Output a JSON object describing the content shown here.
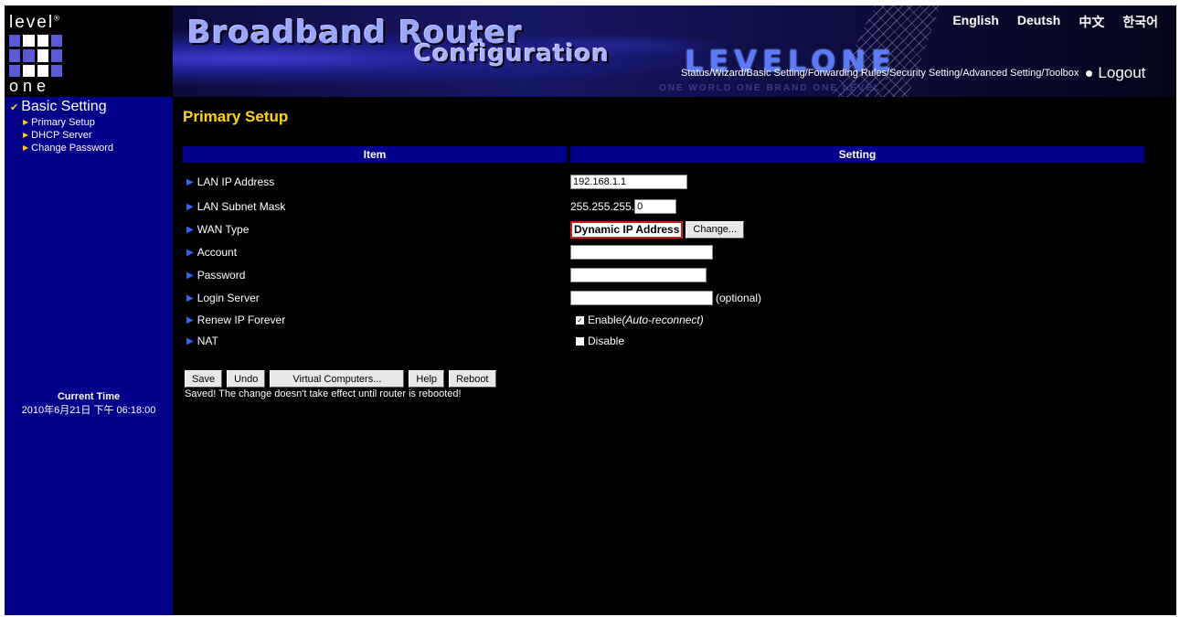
{
  "logo": {
    "top": "level",
    "tm": "®",
    "bottom": "one"
  },
  "banner": {
    "title_line1": "Broadband Router",
    "title_line2": "Configuration",
    "brand": "LEVELONE",
    "slogan": "ONE WORLD ONE BRAND ONE LEVEL"
  },
  "languages": [
    "English",
    "Deutsh",
    "中文",
    "한국어"
  ],
  "nav": {
    "items": [
      "Status",
      "Wizard",
      "Basic Setting",
      "Forwarding Rules",
      "Security Setting",
      "Advanced Setting",
      "Toolbox"
    ],
    "separator": "/ ",
    "logout": "Logout"
  },
  "sidebar": {
    "section": "Basic Setting",
    "items": [
      "Primary Setup",
      "DHCP Server",
      "Change Password"
    ],
    "time_label": "Current Time",
    "time_value": "2010年6月21日 下午 06:18:00"
  },
  "page": {
    "title": "Primary Setup",
    "col_item": "Item",
    "col_setting": "Setting"
  },
  "fields": {
    "lan_ip": {
      "label": "LAN IP Address",
      "value": "192.168.1.1"
    },
    "subnet": {
      "label": "LAN Subnet Mask",
      "prefix": "255.255.255.",
      "value": "0"
    },
    "wan_type": {
      "label": "WAN Type",
      "value": "Dynamic IP Address",
      "change": "Change..."
    },
    "account": {
      "label": "Account",
      "value": ""
    },
    "password": {
      "label": "Password",
      "value": ""
    },
    "login_server": {
      "label": "Login Server",
      "value": "",
      "hint": "(optional)"
    },
    "renew": {
      "label": "Renew IP Forever",
      "option": "Enable",
      "option_hint": "(Auto-reconnect)",
      "checked": true
    },
    "nat": {
      "label": "NAT",
      "option": "Disable",
      "checked": false
    }
  },
  "buttons": {
    "save": "Save",
    "undo": "Undo",
    "virtual": "Virtual Computers...",
    "help": "Help",
    "reboot": "Reboot"
  },
  "message": "Saved! The change doesn't take effect until router is rebooted!",
  "colors": {
    "sidebar_bg": "#00008b",
    "title": "#ffd700",
    "header_bg": "#00008b",
    "wan_border": "#cc2222"
  }
}
